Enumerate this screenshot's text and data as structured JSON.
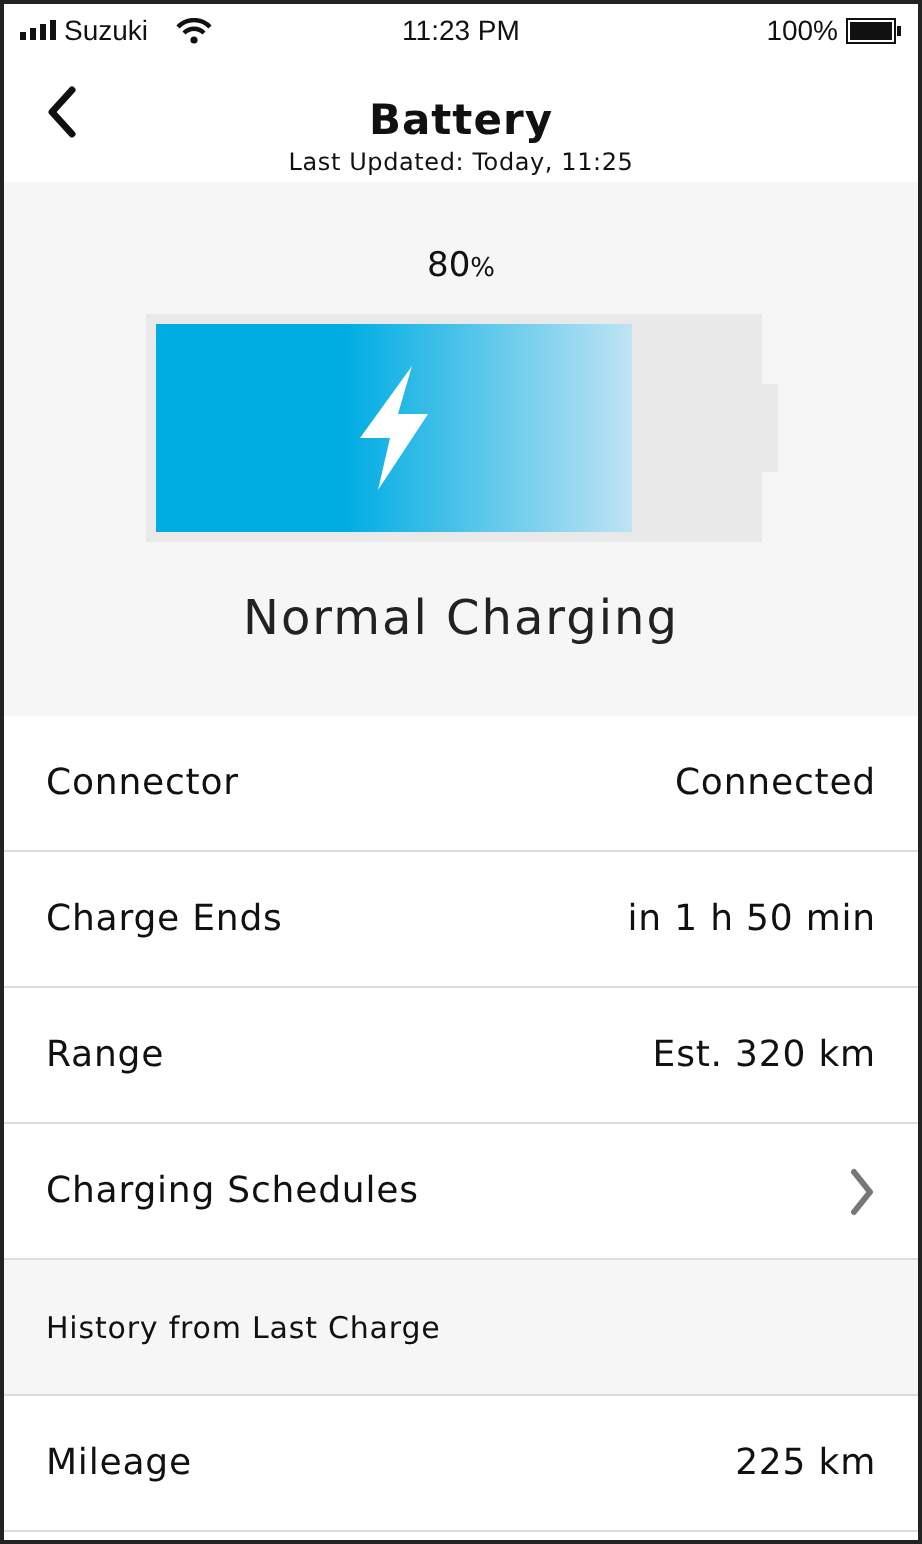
{
  "status_bar": {
    "carrier": "Suzuki",
    "time": "11:23 PM",
    "battery": "100%"
  },
  "header": {
    "title": "Battery",
    "subtitle": "Last Updated: Today, 11:25"
  },
  "battery": {
    "percent": "80",
    "unit": "%",
    "level": 0.8,
    "charging": true,
    "mode": "Normal Charging"
  },
  "rows": [
    {
      "kind": "value",
      "label": "Connector",
      "value": "Connected"
    },
    {
      "kind": "value",
      "label": "Charge Ends",
      "value": "in 1 h 50 min"
    },
    {
      "kind": "value",
      "label": "Range",
      "value": "Est. 320 km"
    },
    {
      "kind": "link",
      "label": "Charging Schedules"
    },
    {
      "kind": "section",
      "label": "History from Last Charge"
    },
    {
      "kind": "value",
      "label": "Mileage",
      "value": "225 km"
    }
  ]
}
